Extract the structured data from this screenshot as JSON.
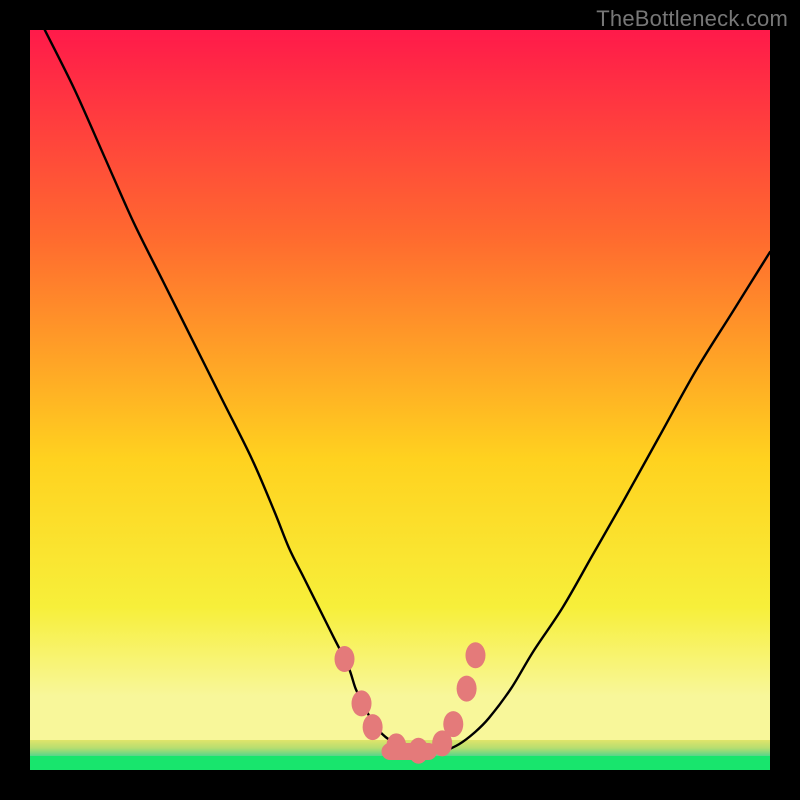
{
  "attribution": "TheBottleneck.com",
  "colors": {
    "frame": "#000000",
    "gradient_top": "#ff1a4a",
    "gradient_mid_upper": "#ff6a2f",
    "gradient_mid": "#ffd21f",
    "gradient_lower": "#f7ef3a",
    "pale_band": "#f8f79a",
    "green_fade_top": "#e0e46a",
    "green_fade_bottom": "#56d68a",
    "green_bar": "#18e56d",
    "curve": "#000000",
    "marker_fill": "#e47a7a",
    "marker_stroke": "#c95a5a"
  },
  "chart_data": {
    "type": "line",
    "title": "",
    "xlabel": "",
    "ylabel": "",
    "xlim": [
      0,
      100
    ],
    "ylim": [
      0,
      100
    ],
    "grid": false,
    "series": [
      {
        "name": "bottleneck-curve",
        "x": [
          2,
          6,
          10,
          14,
          18,
          22,
          26,
          30,
          33,
          35,
          37,
          39,
          41,
          43,
          44,
          45,
          46,
          47,
          48,
          49,
          50,
          51,
          52,
          53,
          54.5,
          56,
          58,
          60,
          62,
          65,
          68,
          72,
          76,
          80,
          85,
          90,
          95,
          100
        ],
        "y": [
          100,
          92,
          83,
          74,
          66,
          58,
          50,
          42,
          35,
          30,
          26,
          22,
          18,
          14,
          11,
          9,
          7,
          5.5,
          4.5,
          3.8,
          3.2,
          2.8,
          2.6,
          2.4,
          2.4,
          2.6,
          3.5,
          5,
          7,
          11,
          16,
          22,
          29,
          36,
          45,
          54,
          62,
          70
        ]
      }
    ],
    "markers": [
      {
        "x": 42.5,
        "y": 15
      },
      {
        "x": 44.8,
        "y": 9
      },
      {
        "x": 46.3,
        "y": 5.8
      },
      {
        "x": 49.5,
        "y": 3.2
      },
      {
        "x": 52.5,
        "y": 2.6
      },
      {
        "x": 55.7,
        "y": 3.6
      },
      {
        "x": 57.2,
        "y": 6.2
      },
      {
        "x": 59.0,
        "y": 11
      },
      {
        "x": 60.2,
        "y": 15.5
      }
    ],
    "flat_segment": {
      "x0": 47.5,
      "x1": 55,
      "y": 2.5,
      "thickness": 2.3
    }
  }
}
